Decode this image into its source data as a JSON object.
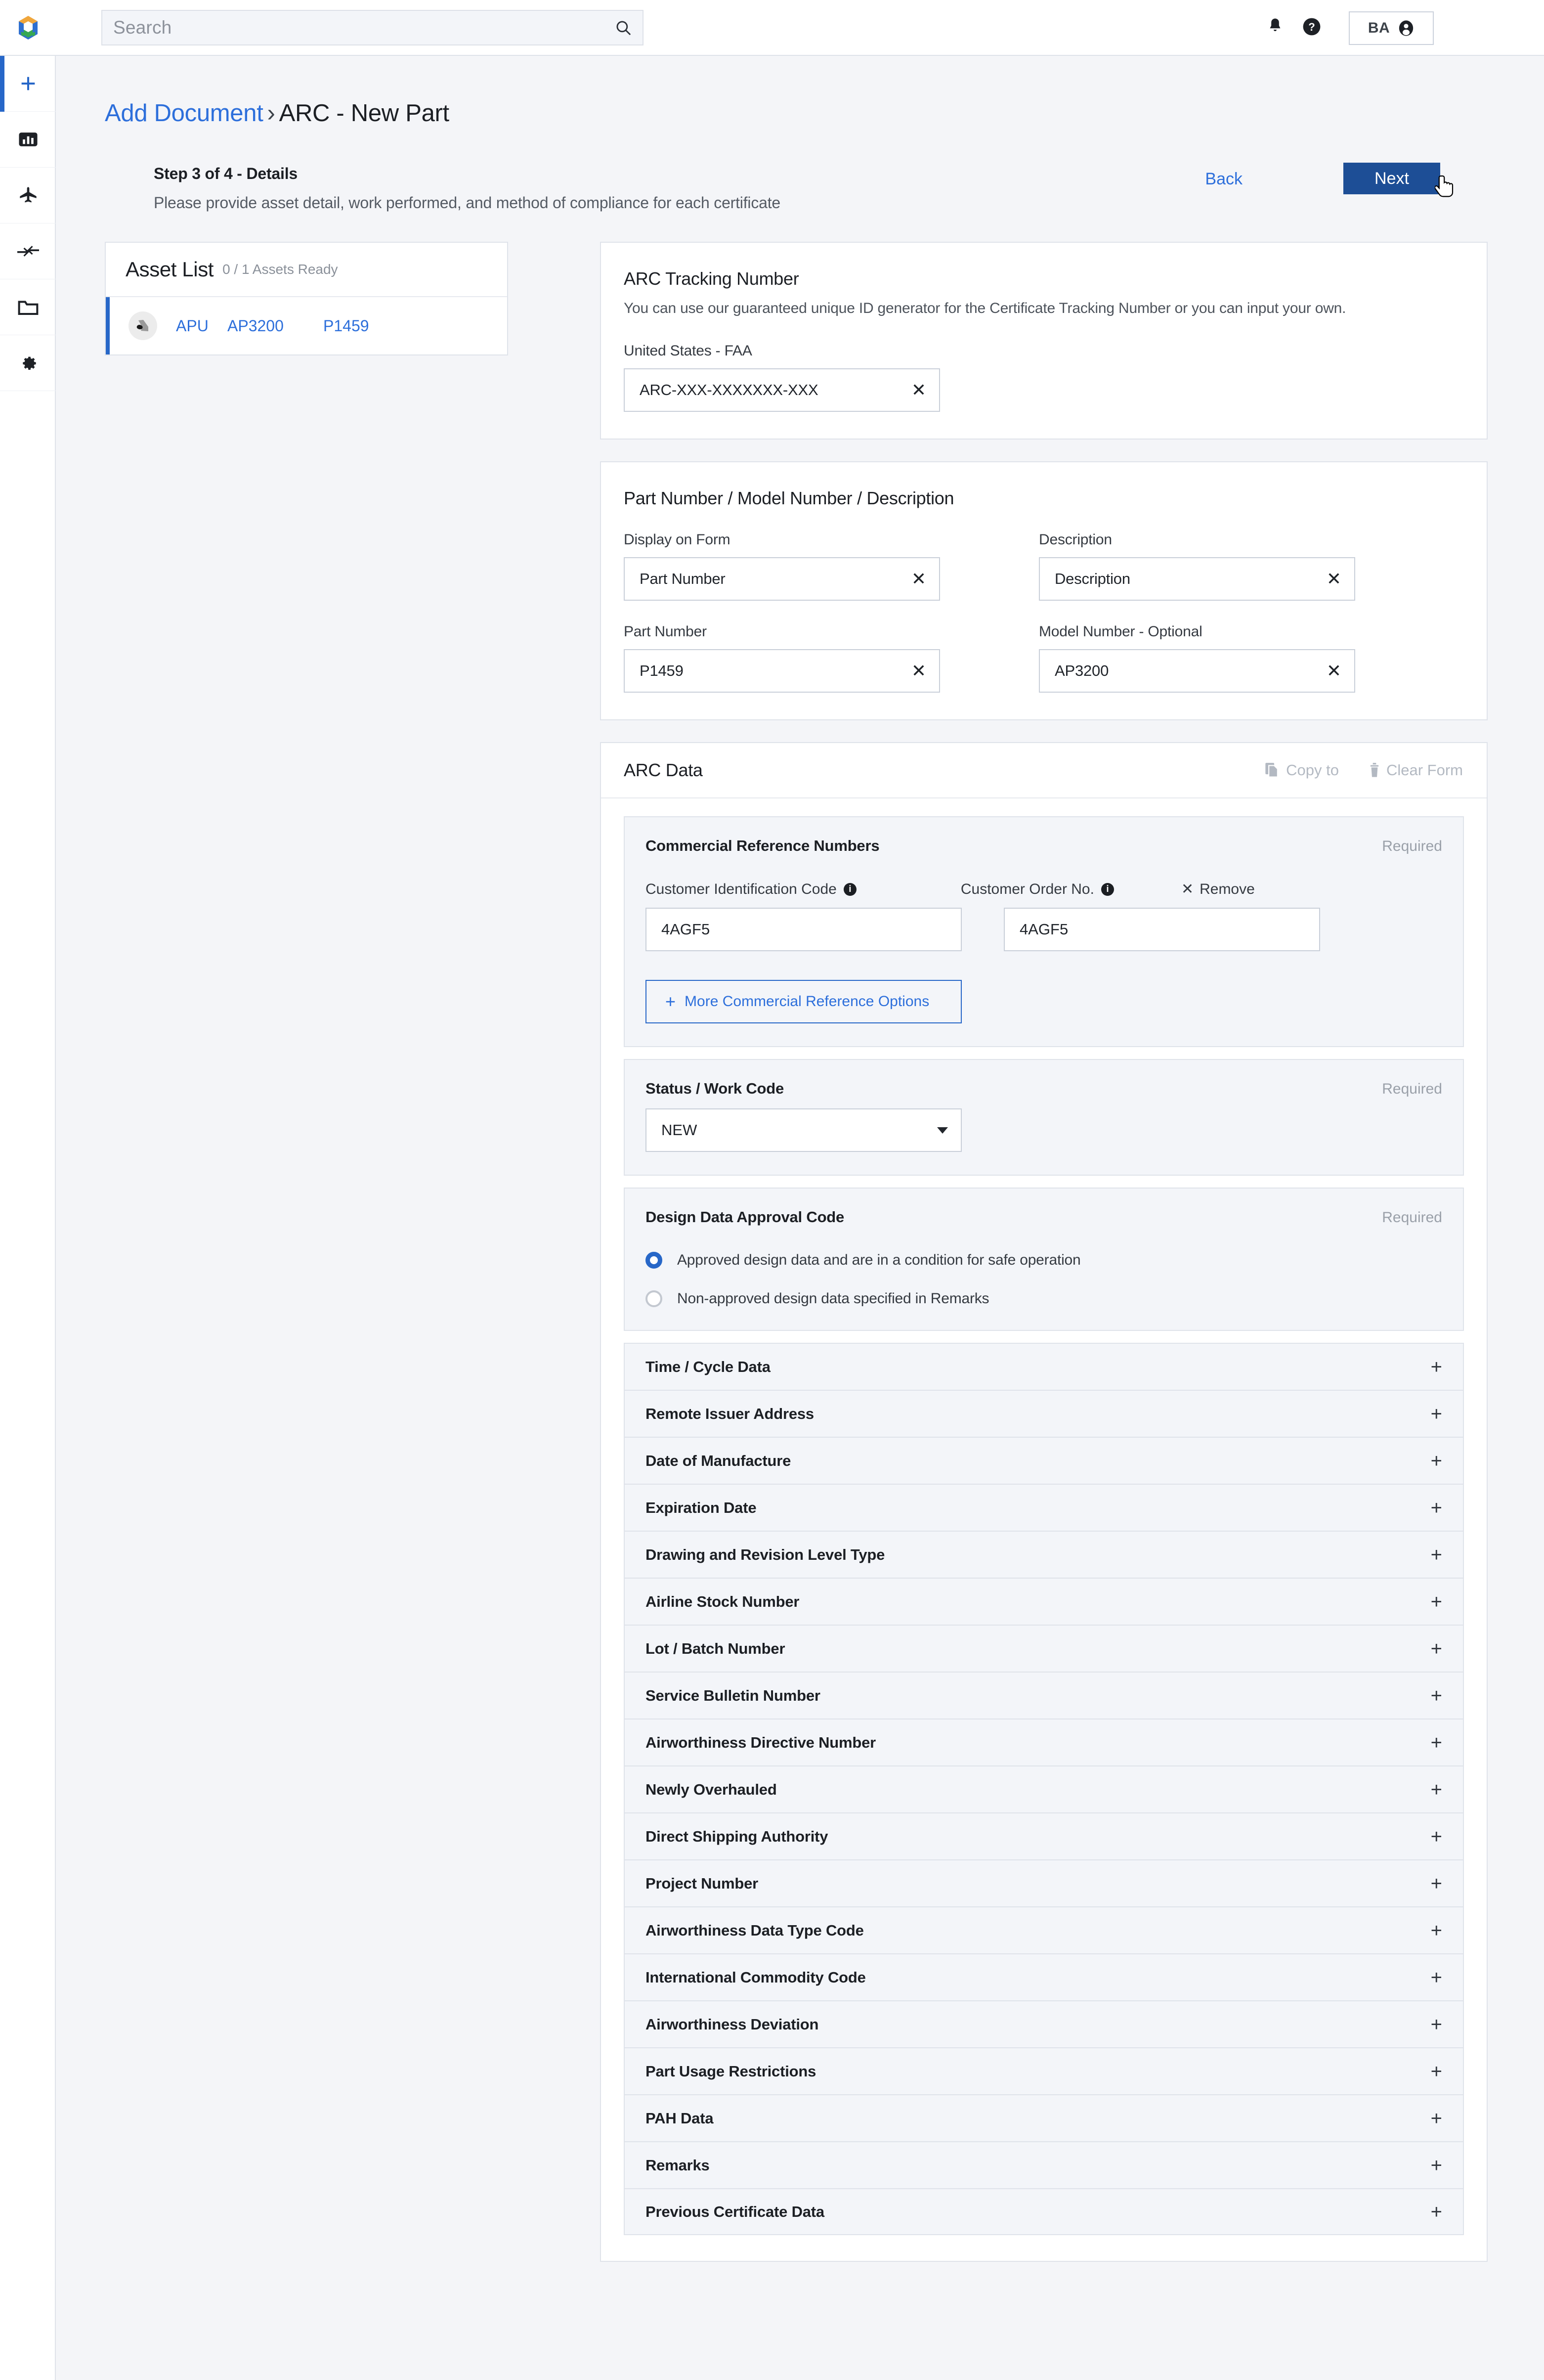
{
  "topbar": {
    "logo_icon": "hexagon-logo",
    "search": {
      "placeholder": "Search",
      "icon": "search-icon"
    },
    "notifications_icon": "bell-icon",
    "help_icon": "help-circle-icon",
    "user": {
      "initials": "BA",
      "avatar_icon": "account-circle-icon"
    }
  },
  "sidebar": {
    "items": [
      {
        "icon": "plus-icon",
        "name": "add"
      },
      {
        "icon": "bar-chart-icon",
        "name": "dashboard"
      },
      {
        "icon": "airplane-icon",
        "name": "fleet"
      },
      {
        "icon": "transfer-arrows-icon",
        "name": "transfers"
      },
      {
        "icon": "folder-icon",
        "name": "documents"
      },
      {
        "icon": "gear-icon",
        "name": "settings"
      }
    ]
  },
  "page": {
    "breadcrumb_link": "Add Document",
    "breadcrumb_sep": "›",
    "breadcrumb_current": "ARC - New Part",
    "step_title": "Step 3 of 4 - Details",
    "step_subtitle": "Please provide asset detail, work performed, and method of compliance for each certificate",
    "back_label": "Back",
    "next_label": "Next"
  },
  "asset_list": {
    "title": "Asset List",
    "count": "0 / 1 Assets Ready",
    "rows": [
      {
        "icon": "apu-engine-icon",
        "type": "APU",
        "model": "AP3200",
        "part": "P1459"
      }
    ]
  },
  "tracking": {
    "title": "ARC Tracking Number",
    "description": "You can use our guaranteed unique ID generator for the Certificate Tracking Number or you can input your own.",
    "field_label": "United States - FAA",
    "value": "ARC-XXX-XXXXXXX-XXX",
    "clear_icon": "close-icon"
  },
  "part_card": {
    "title": "Part Number / Model Number / Description",
    "fields": [
      {
        "label": "Display on Form",
        "value": "Part Number"
      },
      {
        "label": "Description",
        "value": "Description"
      },
      {
        "label": "Part Number",
        "value": "P1459"
      },
      {
        "label": "Model Number - Optional",
        "value": "AP3200"
      }
    ]
  },
  "arc_data": {
    "title": "ARC Data",
    "copy_to": {
      "label": "Copy to",
      "icon": "copy-icon"
    },
    "clear_form": {
      "label": "Clear Form",
      "icon": "trash-icon"
    },
    "commercial": {
      "title": "Commercial Reference Numbers",
      "required": "Required",
      "cic_label": "Customer Identification Code",
      "cic_value": "4AGF5",
      "con_label": "Customer Order No.",
      "con_value": "4AGF5",
      "remove_label": "Remove",
      "remove_icon": "close-icon",
      "info_icon": "info-icon",
      "more_label": "More Commercial Reference Options",
      "more_icon": "plus-icon"
    },
    "status": {
      "title": "Status /  Work Code",
      "required": "Required",
      "value": "NEW",
      "caret_icon": "chevron-down-icon"
    },
    "design": {
      "title": "Design Data Approval Code",
      "required": "Required",
      "options": [
        {
          "label": "Approved design data and are in a condition for safe operation",
          "selected": true
        },
        {
          "label": "Non-approved design data specified in Remarks",
          "selected": false
        }
      ]
    },
    "sections": [
      "Time / Cycle Data",
      "Remote Issuer Address",
      "Date of Manufacture",
      "Expiration Date",
      "Drawing and Revision Level Type",
      "Airline Stock Number",
      "Lot / Batch Number",
      "Service Bulletin Number",
      "Airworthiness Directive Number",
      "Newly Overhauled",
      "Direct Shipping Authority",
      "Project Number",
      "Airworthiness Data Type Code",
      "International Commodity Code",
      "Airworthiness Deviation",
      "Part Usage Restrictions",
      "PAH Data",
      "Remarks",
      "Previous Certificate Data"
    ],
    "expand_icon": "plus-icon"
  },
  "colors": {
    "accent_blue": "#2d6fdb",
    "primary_button": "#1d4e96",
    "page_bg": "#f4f5f8",
    "panel_bg": "#f3f5f9",
    "border": "#dfe3ea"
  }
}
